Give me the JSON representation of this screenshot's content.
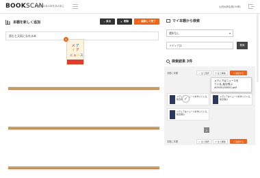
{
  "header": {
    "logo_bold": "BOOK",
    "logo_light": "SCAN",
    "tagline": "世界中のあの本をあの本に",
    "user": "山田太郎会員(30冊)"
  },
  "left": {
    "title": "本棚を新しく追加",
    "back_label": "戻る",
    "delete_label": "削除",
    "done_label": "編集して完了",
    "shelf_name": "読むと元気になれる本",
    "book": {
      "title_chars": [
        "メ",
        "デ",
        "ィ",
        "ア",
        "ニ",
        "ュ",
        "ー",
        "ス"
      ],
      "badge": "1"
    }
  },
  "right": {
    "search_title": "マイ本棚から検索",
    "select_value": "選択なし",
    "search_field_value": "メディアは",
    "search_button": "検索",
    "results_title": "検索結果 3件",
    "label_top": "書籍に本棚",
    "select_all": "全て選択",
    "deselect_all": "全て解除",
    "add_label": "追加する",
    "tooltip_lines": [
      "メディアはニュースを",
      "ている_絵空飛ぶ",
      "#2905150051.pdf"
    ],
    "results": [
      {
        "title": "メディアはニュースを作っている_絵空飛ぶ"
      },
      {
        "title": "メディアはニュースを作っている_絵空飛ぶ"
      },
      {
        "title": "メディアはニュースを作っている_絵空飛ぶ"
      }
    ],
    "page_number": "1",
    "label_bottom": "書籍に本棚"
  }
}
